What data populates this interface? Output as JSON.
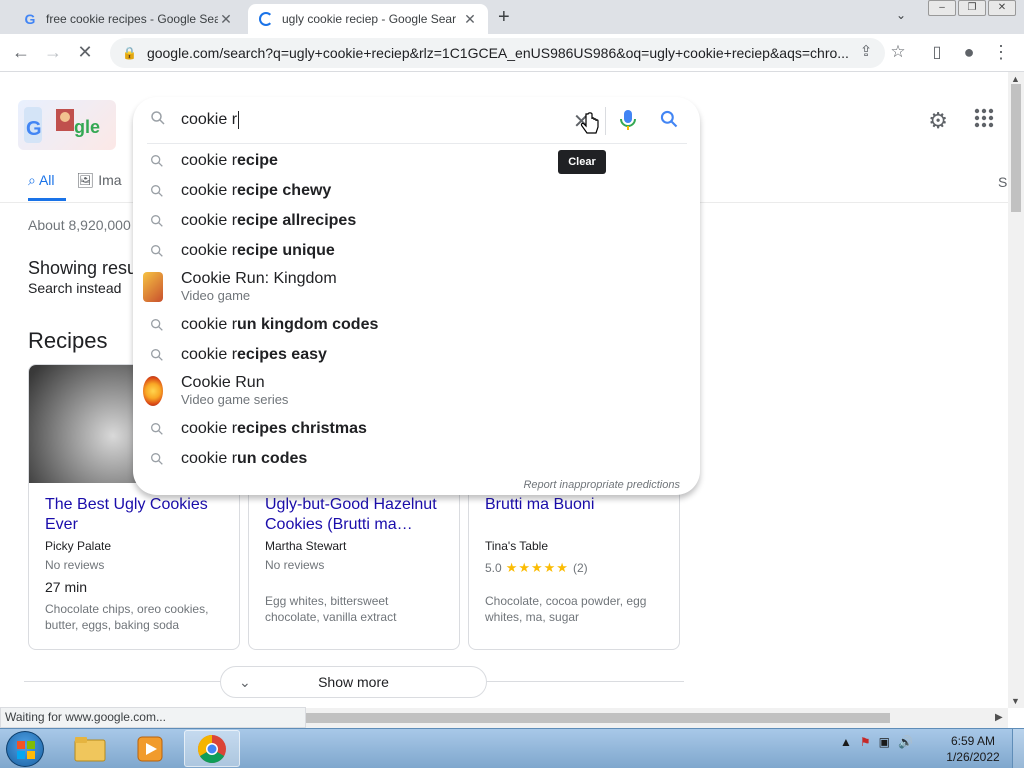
{
  "browser": {
    "tabs": [
      {
        "title": "free cookie recipes - Google Sea",
        "close": "✕"
      },
      {
        "title": "ugly cookie reciep - Google Sear",
        "close": "✕"
      }
    ],
    "new_tab": "+",
    "tab_search": "⌄",
    "window_buttons": {
      "minimize": "–",
      "restore": "❐",
      "close": "✕"
    },
    "url": "google.com/search?q=ugly+cookie+reciep&rlz=1C1GCEA_enUS986US986&oq=ugly+cookie+reciep&aqs=chro...",
    "status": "Waiting for www.google.com..."
  },
  "search": {
    "query": "cookie r",
    "clear_tooltip": "Clear",
    "suggestions": [
      {
        "type": "query",
        "prefix": "cookie r",
        "bold": "ecipe"
      },
      {
        "type": "query",
        "prefix": "cookie r",
        "bold": "ecipe chewy"
      },
      {
        "type": "query",
        "prefix": "cookie r",
        "bold": "ecipe allrecipes"
      },
      {
        "type": "query",
        "prefix": "cookie r",
        "bold": "ecipe unique"
      },
      {
        "type": "entity",
        "title": "Cookie Run: Kingdom",
        "subtitle": "Video game"
      },
      {
        "type": "query",
        "prefix": "cookie r",
        "bold": "un kingdom codes"
      },
      {
        "type": "query",
        "prefix": "cookie r",
        "bold": "ecipes easy"
      },
      {
        "type": "entity",
        "title": "Cookie Run",
        "subtitle": "Video game series"
      },
      {
        "type": "query",
        "prefix": "cookie r",
        "bold": "ecipes christmas"
      },
      {
        "type": "query",
        "prefix": "cookie r",
        "bold": "un codes"
      }
    ],
    "report": "Report inappropriate predictions"
  },
  "page": {
    "nav": {
      "all": "All",
      "images": "Ima",
      "right": "S"
    },
    "results_count": "About 8,920,000",
    "showing": "Showing resu",
    "search_instead": "Search instead",
    "recipes_title": "Recipes",
    "recipes_menu": "⋮",
    "cards": [
      {
        "title": "The Best Ugly Cookies Ever",
        "source": "Picky Palate",
        "reviews": "No reviews",
        "time": "27 min",
        "ingredients": "Chocolate chips, oreo cookies, butter, eggs, baking soda"
      },
      {
        "title": "Ugly-but-Good Hazelnut Cookies (Brutti ma…",
        "source": "Martha Stewart",
        "reviews": "No reviews",
        "ingredients": "Egg whites, bittersweet chocolate, vanilla extract"
      },
      {
        "title": "Brutti ma Buoni",
        "source": "Tina's Table",
        "rating": "5.0",
        "stars": "★★★★★",
        "rating_count": "(2)",
        "ingredients": "Chocolate, cocoa powder, egg whites, ma, sugar"
      }
    ],
    "show_more": "Show more"
  },
  "taskbar": {
    "time": "6:59 AM",
    "date": "1/26/2022",
    "tray_arrow": "▲"
  },
  "colors": {
    "accent": "#1a73e8",
    "link": "#1a0dab",
    "star": "#fbbc04"
  }
}
